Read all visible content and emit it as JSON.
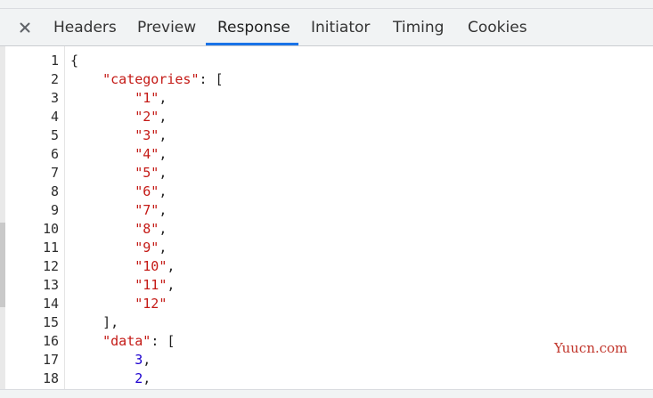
{
  "tabs": [
    {
      "id": "headers",
      "label": "Headers"
    },
    {
      "id": "preview",
      "label": "Preview"
    },
    {
      "id": "response",
      "label": "Response",
      "active": true
    },
    {
      "id": "initiator",
      "label": "Initiator"
    },
    {
      "id": "timing",
      "label": "Timing"
    },
    {
      "id": "cookies",
      "label": "Cookies"
    }
  ],
  "close_icon": "close-icon",
  "colors": {
    "key": "#c41a16",
    "string": "#c41a16",
    "number": "#1c00cf",
    "active_tab_underline": "#1a73e8"
  },
  "code": {
    "line_numbers": [
      "1",
      "2",
      "3",
      "4",
      "5",
      "6",
      "7",
      "8",
      "9",
      "10",
      "11",
      "12",
      "13",
      "14",
      "15",
      "16",
      "17",
      "18"
    ],
    "lines": [
      [
        {
          "t": "p",
          "v": "{"
        }
      ],
      [
        {
          "t": "p",
          "v": "    "
        },
        {
          "t": "k",
          "v": "\"categories\""
        },
        {
          "t": "p",
          "v": ": ["
        }
      ],
      [
        {
          "t": "p",
          "v": "        "
        },
        {
          "t": "s",
          "v": "\"1\""
        },
        {
          "t": "p",
          "v": ","
        }
      ],
      [
        {
          "t": "p",
          "v": "        "
        },
        {
          "t": "s",
          "v": "\"2\""
        },
        {
          "t": "p",
          "v": ","
        }
      ],
      [
        {
          "t": "p",
          "v": "        "
        },
        {
          "t": "s",
          "v": "\"3\""
        },
        {
          "t": "p",
          "v": ","
        }
      ],
      [
        {
          "t": "p",
          "v": "        "
        },
        {
          "t": "s",
          "v": "\"4\""
        },
        {
          "t": "p",
          "v": ","
        }
      ],
      [
        {
          "t": "p",
          "v": "        "
        },
        {
          "t": "s",
          "v": "\"5\""
        },
        {
          "t": "p",
          "v": ","
        }
      ],
      [
        {
          "t": "p",
          "v": "        "
        },
        {
          "t": "s",
          "v": "\"6\""
        },
        {
          "t": "p",
          "v": ","
        }
      ],
      [
        {
          "t": "p",
          "v": "        "
        },
        {
          "t": "s",
          "v": "\"7\""
        },
        {
          "t": "p",
          "v": ","
        }
      ],
      [
        {
          "t": "p",
          "v": "        "
        },
        {
          "t": "s",
          "v": "\"8\""
        },
        {
          "t": "p",
          "v": ","
        }
      ],
      [
        {
          "t": "p",
          "v": "        "
        },
        {
          "t": "s",
          "v": "\"9\""
        },
        {
          "t": "p",
          "v": ","
        }
      ],
      [
        {
          "t": "p",
          "v": "        "
        },
        {
          "t": "s",
          "v": "\"10\""
        },
        {
          "t": "p",
          "v": ","
        }
      ],
      [
        {
          "t": "p",
          "v": "        "
        },
        {
          "t": "s",
          "v": "\"11\""
        },
        {
          "t": "p",
          "v": ","
        }
      ],
      [
        {
          "t": "p",
          "v": "        "
        },
        {
          "t": "s",
          "v": "\"12\""
        }
      ],
      [
        {
          "t": "p",
          "v": "    ],"
        }
      ],
      [
        {
          "t": "p",
          "v": "    "
        },
        {
          "t": "k",
          "v": "\"data\""
        },
        {
          "t": "p",
          "v": ": ["
        }
      ],
      [
        {
          "t": "p",
          "v": "        "
        },
        {
          "t": "n",
          "v": "3"
        },
        {
          "t": "p",
          "v": ","
        }
      ],
      [
        {
          "t": "p",
          "v": "        "
        },
        {
          "t": "n",
          "v": "2"
        },
        {
          "t": "p",
          "v": ","
        }
      ]
    ]
  },
  "watermark": "Yuucn.com"
}
